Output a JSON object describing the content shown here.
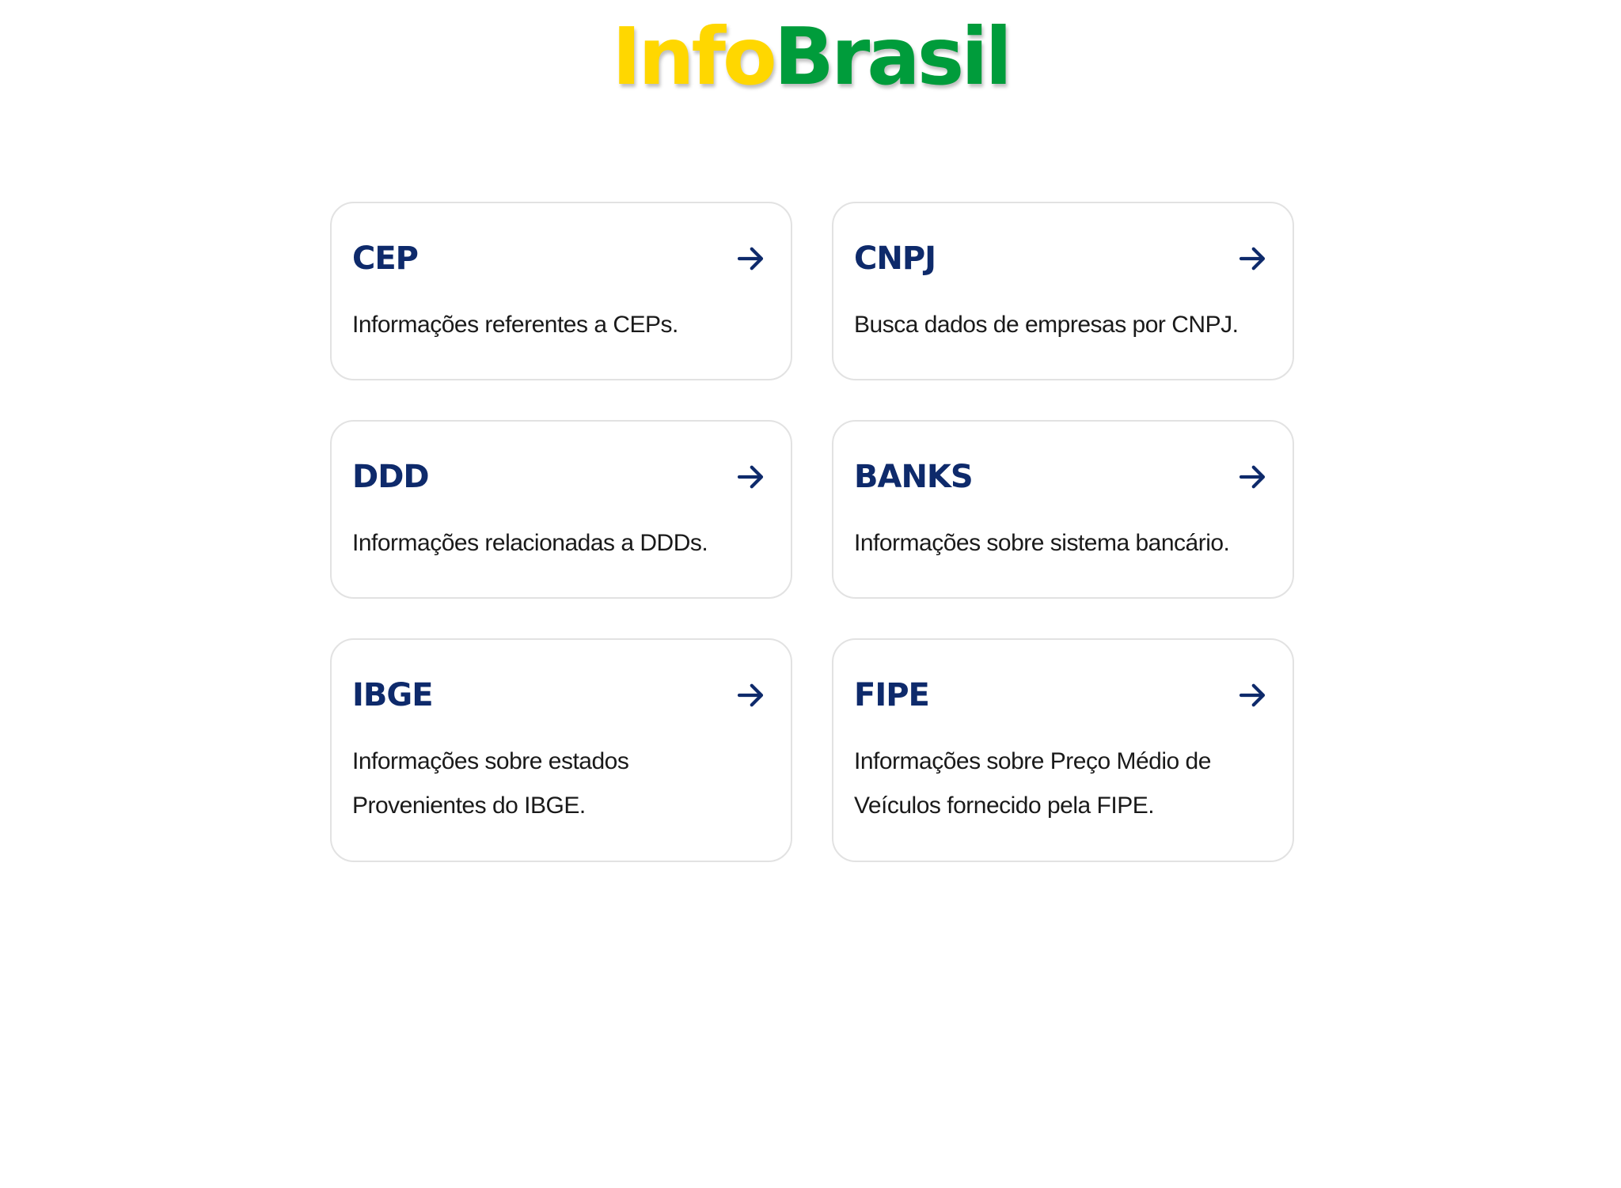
{
  "logo": {
    "part1": "Info",
    "part2": "Brasil",
    "colors": {
      "part1": "#FFD700",
      "part2": "#009C3B"
    }
  },
  "cards": [
    {
      "title": "CEP",
      "description": "Informações referentes a CEPs.",
      "icon": "arrow-right-icon"
    },
    {
      "title": "CNPJ",
      "description": "Busca dados de empresas por CNPJ.",
      "icon": "arrow-right-icon"
    },
    {
      "title": "DDD",
      "description": "Informações relacionadas a DDDs.",
      "icon": "arrow-right-icon"
    },
    {
      "title": "BANKS",
      "description": "Informações sobre sistema bancário.",
      "icon": "arrow-right-icon"
    },
    {
      "title": "IBGE",
      "description": "Informações sobre estados Provenientes do IBGE.",
      "icon": "arrow-right-icon"
    },
    {
      "title": "FIPE",
      "description": "Informações sobre Preço Médio de Veículos fornecido pela FIPE.",
      "icon": "arrow-right-icon"
    }
  ],
  "theme": {
    "title_color": "#0e2a6b",
    "text_color": "#1a1a1a",
    "border_color": "#e2e2e2"
  }
}
